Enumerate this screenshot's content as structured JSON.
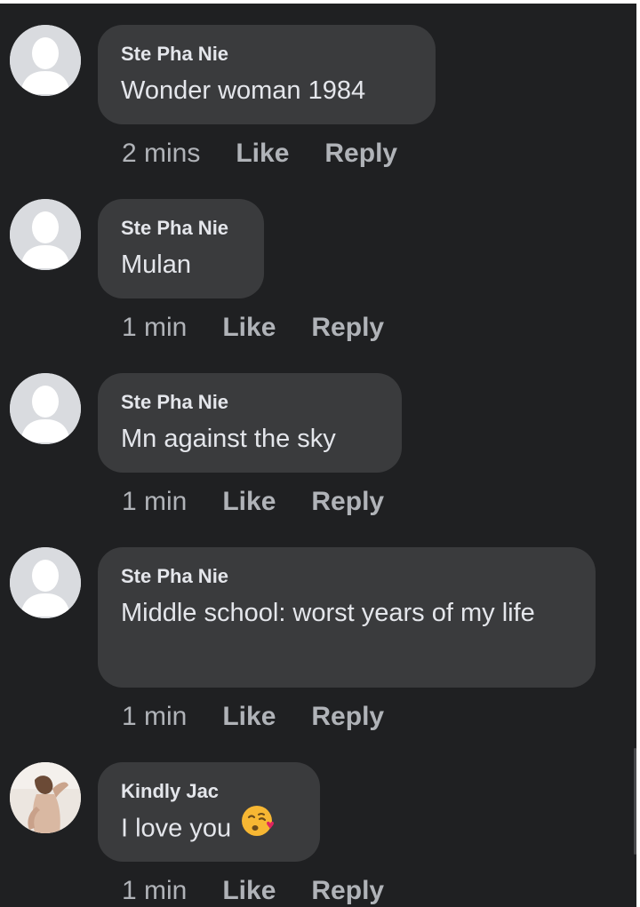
{
  "comments": [
    {
      "author": "Ste Pha Nie",
      "text": "Wonder woman 1984",
      "time": "2 mins",
      "like": "Like",
      "reply": "Reply",
      "avatar": "default-avatar-icon"
    },
    {
      "author": "Ste Pha Nie",
      "text": "Mulan",
      "time": "1 min",
      "like": "Like",
      "reply": "Reply",
      "avatar": "default-avatar-icon"
    },
    {
      "author": "Ste Pha Nie",
      "text": "Mn against the sky",
      "time": "1 min",
      "like": "Like",
      "reply": "Reply",
      "avatar": "default-avatar-icon"
    },
    {
      "author": "Ste Pha Nie",
      "text": "Middle school: worst years of my life",
      "time": "1 min",
      "like": "Like",
      "reply": "Reply",
      "avatar": "default-avatar-icon"
    },
    {
      "author": "Kindly Jac",
      "text": "I love you",
      "emoji": "kissing-face-heart-icon",
      "time": "1 min",
      "like": "Like",
      "reply": "Reply",
      "avatar": "profile-photo-avatar"
    }
  ],
  "colors": {
    "background": "#1f2022",
    "bubble": "#3a3b3d",
    "text": "#e4e6eb",
    "meta": "#b0b3b8"
  }
}
